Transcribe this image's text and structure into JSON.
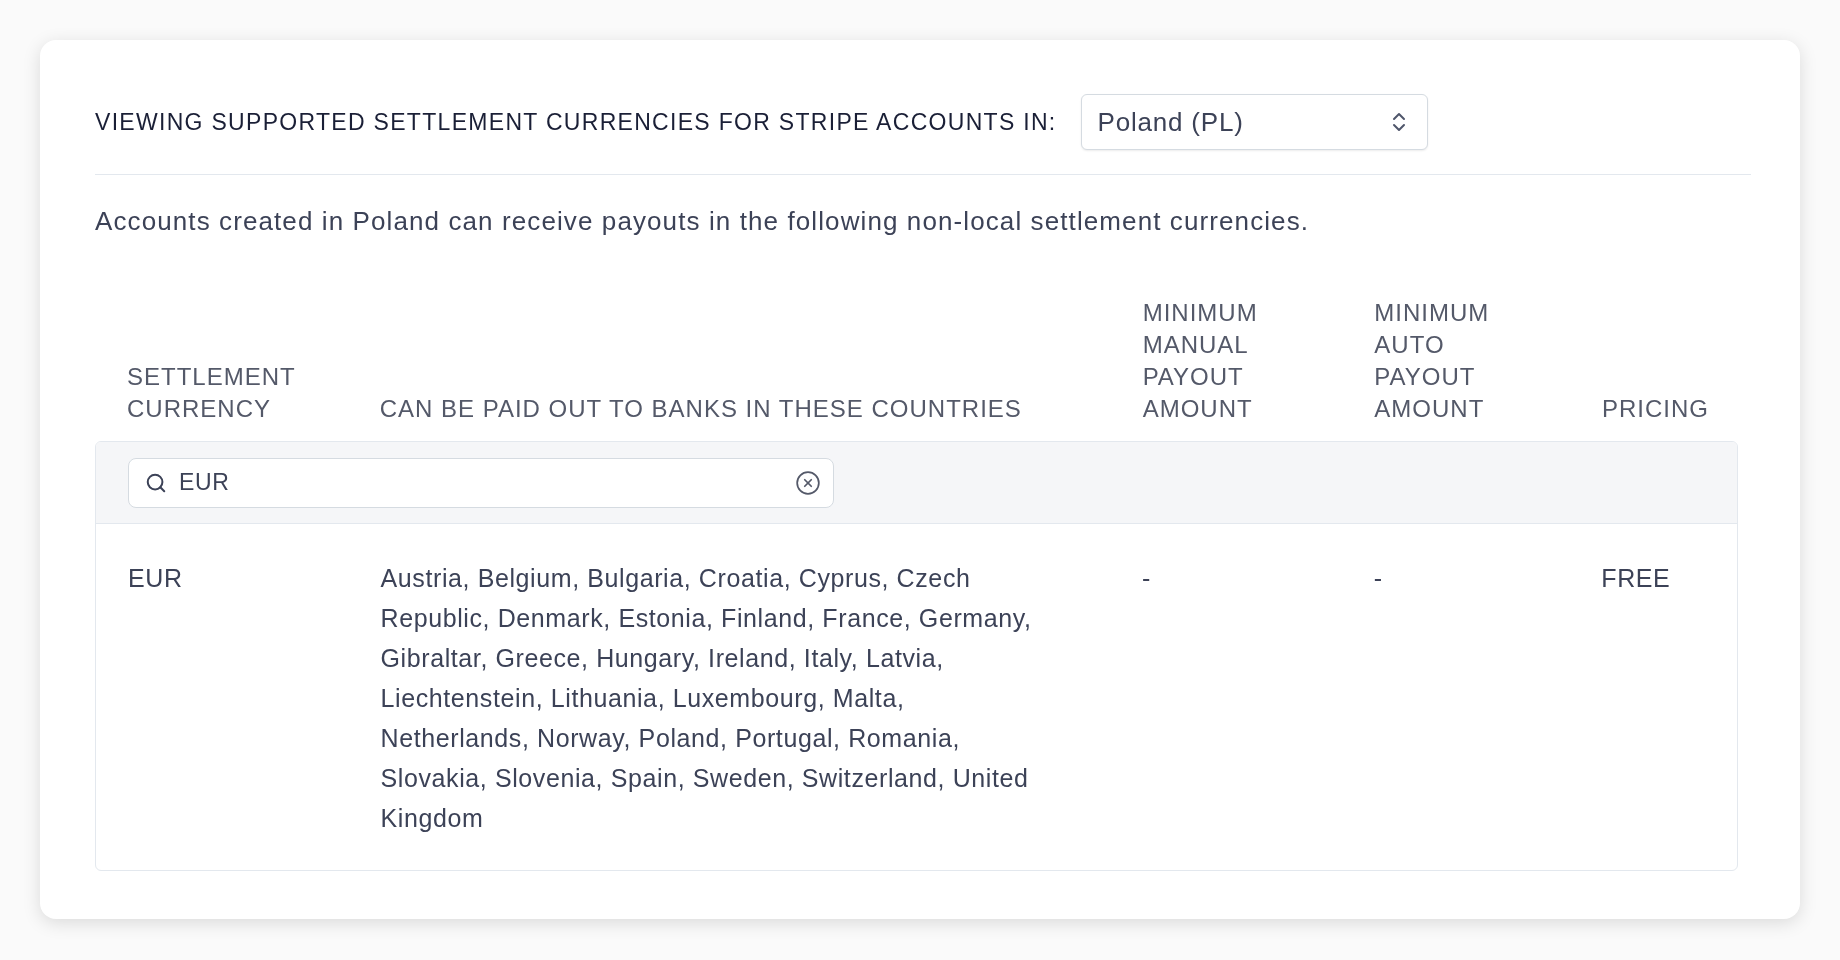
{
  "header": {
    "label": "VIEWING SUPPORTED SETTLEMENT CURRENCIES FOR STRIPE ACCOUNTS IN:",
    "country_select": {
      "value": "Poland (PL)"
    }
  },
  "description": "Accounts created in Poland can receive payouts in the following non-local settlement currencies.",
  "table": {
    "columns": [
      "SETTLEMENT CURRENCY",
      "CAN BE PAID OUT TO BANKS IN THESE COUNTRIES",
      "MINIMUM MANUAL PAYOUT AMOUNT",
      "MINIMUM AUTO PAYOUT AMOUNT",
      "PRICING"
    ],
    "search": {
      "value": "EUR"
    },
    "rows": [
      {
        "cells": [
          "EUR",
          "Austria, Belgium, Bulgaria, Croatia, Cyprus, Czech Republic, Denmark, Estonia, Finland, France, Germany, Gibraltar, Greece, Hungary, Ireland, Italy, Latvia, Liechtenstein, Lithuania, Luxembourg, Malta, Netherlands, Norway, Poland, Portugal, Romania, Slovakia, Slovenia, Spain, Sweden, Switzerland, United Kingdom",
          "-",
          "-",
          "FREE"
        ]
      }
    ]
  }
}
